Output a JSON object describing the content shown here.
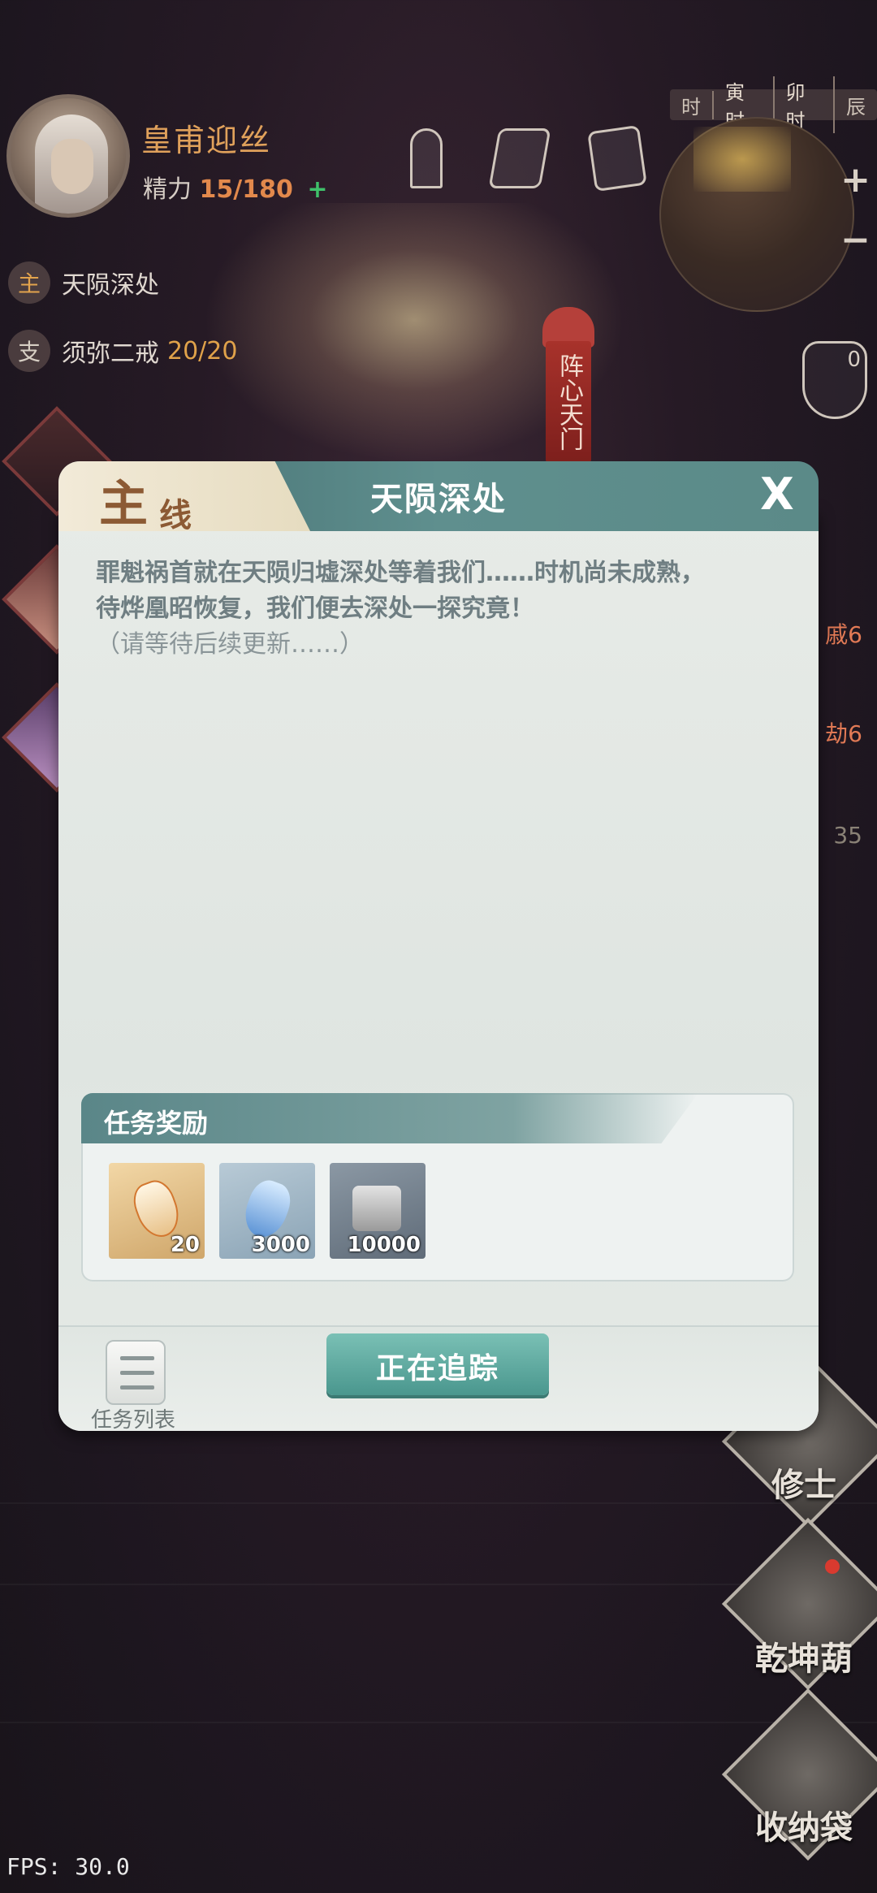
{
  "player": {
    "name": "皇甫迎丝",
    "energy_label": "精力",
    "energy_value": "15/180",
    "energy_plus": "+"
  },
  "time_bar": [
    "时",
    "寅时",
    "卯时",
    "辰"
  ],
  "zoom": {
    "in": "+",
    "out": "−"
  },
  "quests": {
    "main_badge": "主",
    "main_name": "天陨深处",
    "side_badge": "支",
    "side_name": "须弥二戒",
    "side_count": "20/20"
  },
  "banner": "阵心天门",
  "right_panel": {
    "count": "0",
    "partial1": "戚6",
    "partial2": "劫6",
    "partial3": "35"
  },
  "side_buttons": {
    "xiushi": "修士",
    "qiankunhu": "乾坤葫",
    "shounadai": "收纳袋"
  },
  "fps": "FPS: 30.0",
  "dialog": {
    "tag_big": "主",
    "tag_small": "线",
    "title": "天陨深处",
    "close": "X",
    "description_line1": "罪魁祸首就在天陨归墟深处等着我们……时机尚未成熟，",
    "description_line2": "待烨凰昭恢复，我们便去深处一探究竟！",
    "description_note": "（请等待后续更新……）",
    "reward_title": "任务奖励",
    "rewards": [
      {
        "icon": "spirit-stone-gold-icon",
        "qty": "20"
      },
      {
        "icon": "blue-crystal-icon",
        "qty": "3000"
      },
      {
        "icon": "scroll-bundle-icon",
        "qty": "10000"
      }
    ],
    "list_label": "任务列表",
    "track_label": "正在追踪"
  }
}
